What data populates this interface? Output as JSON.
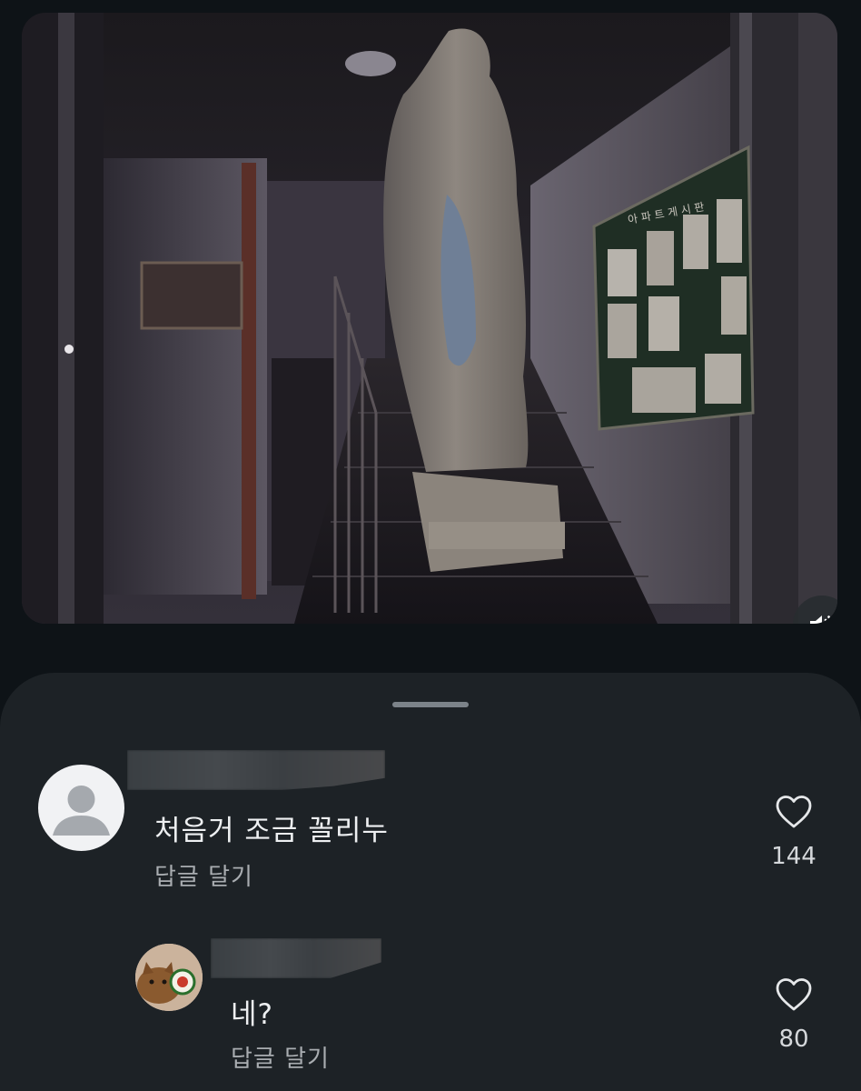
{
  "media": {
    "poster_sign": "아 파 트 게 시 판",
    "sound_icon": "volume-icon"
  },
  "comments": [
    {
      "text": "처음거 조금 꼴리누",
      "reply_label": "답글 달기",
      "likes": "144",
      "avatar_icon": "default-user-avatar",
      "like_icon": "heart-outline-icon"
    },
    {
      "text": "네?",
      "reply_label": "답글 달기",
      "likes": "80",
      "avatar_icon": "cat-photo-avatar",
      "like_icon": "heart-outline-icon"
    }
  ],
  "colors": {
    "background": "#0e1317",
    "sheet": "#1d2226",
    "handle": "#7c8389"
  }
}
